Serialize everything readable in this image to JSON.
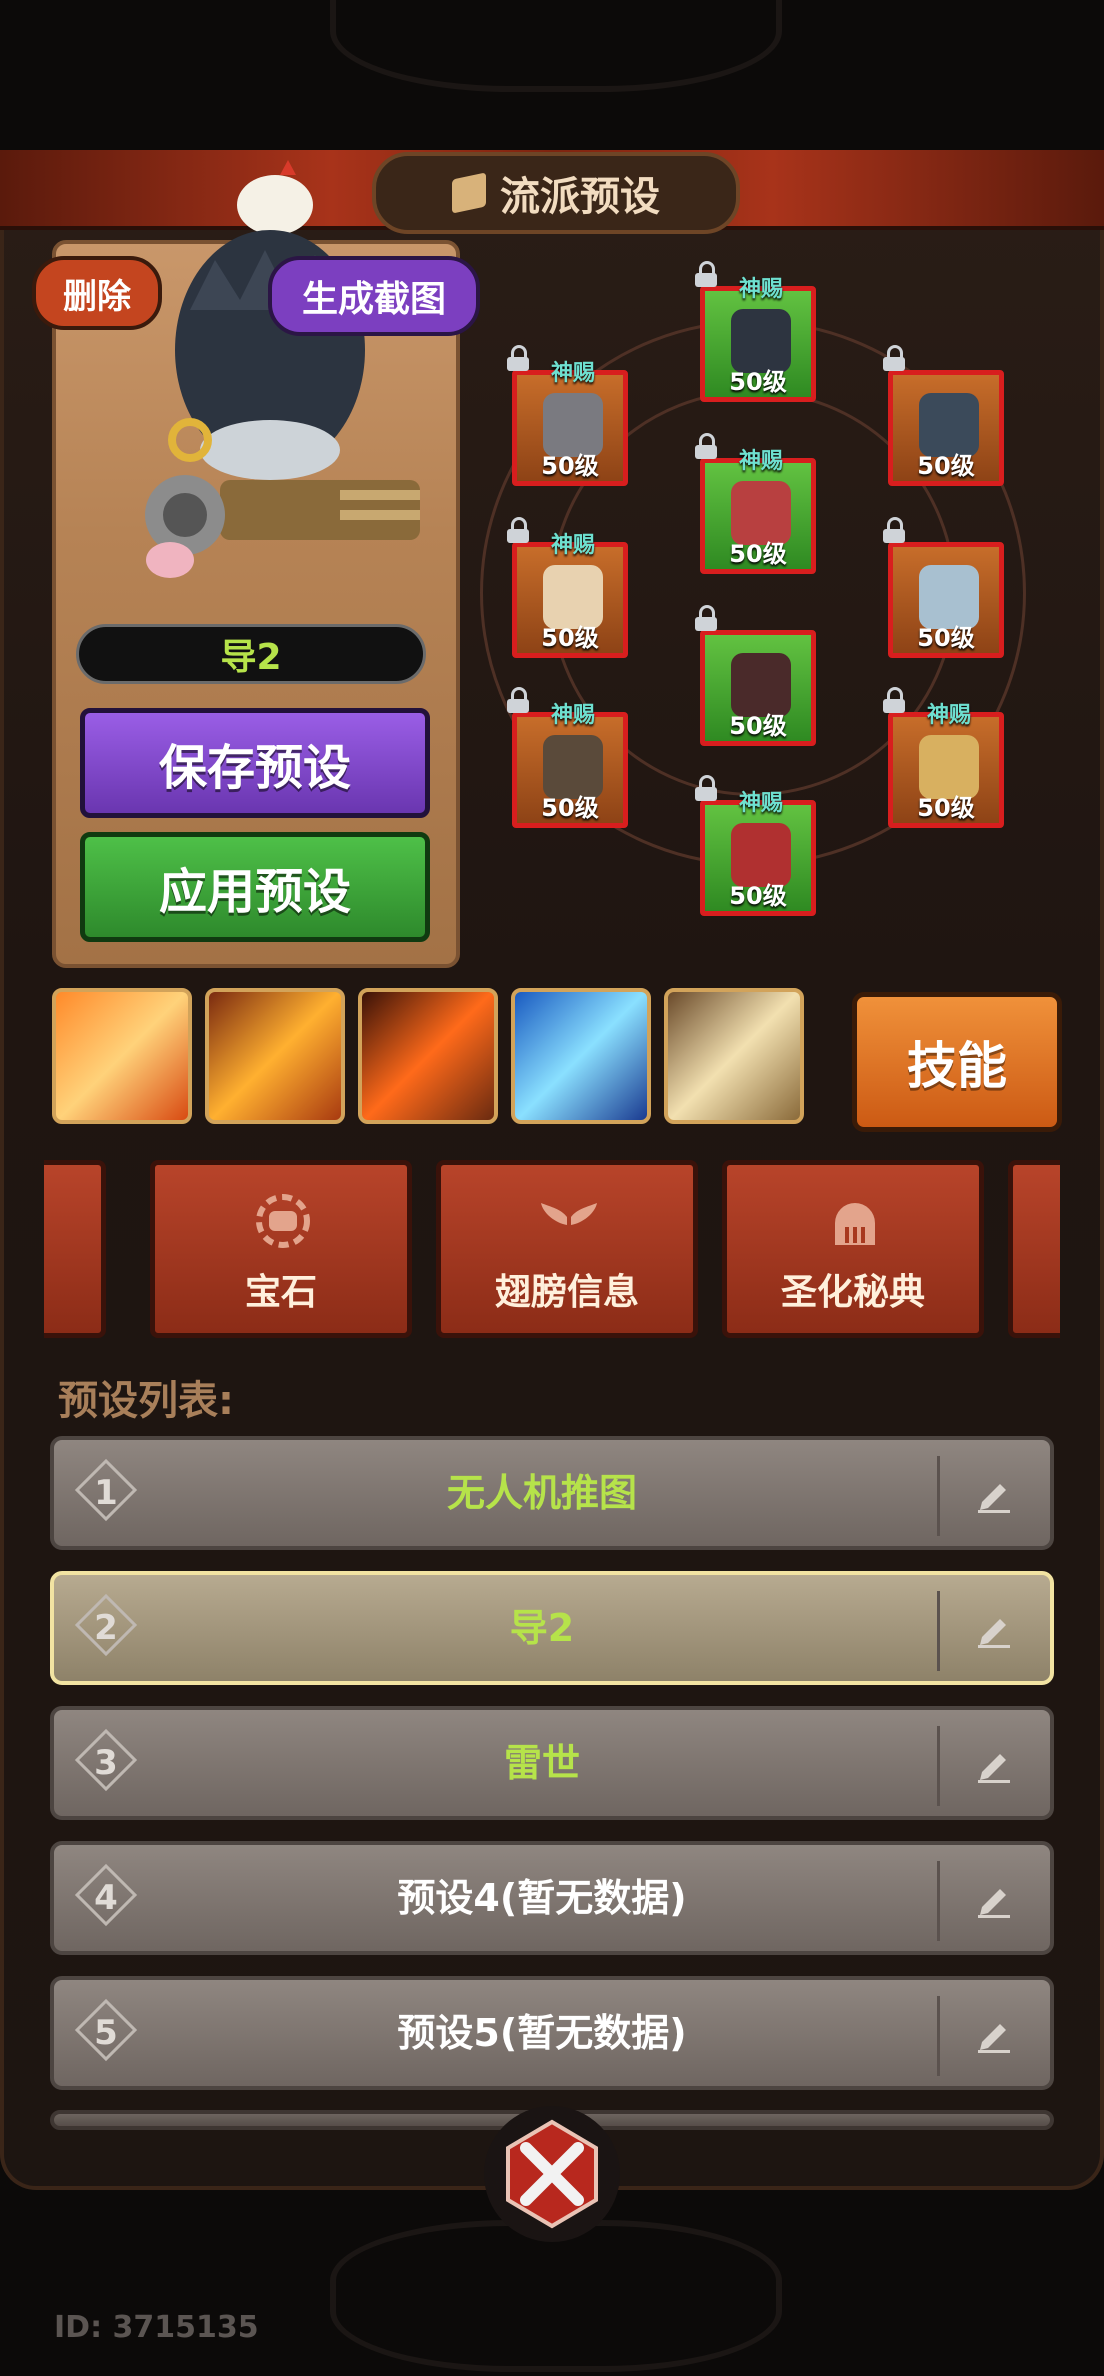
{
  "header": {
    "title": "流派预设"
  },
  "character_card": {
    "delete_label": "删除",
    "screenshot_label": "生成截图",
    "preset_name": "导2",
    "save_label": "保存预设",
    "apply_label": "应用预设"
  },
  "equipment": [
    {
      "tag": "神赐",
      "level": "50级",
      "rarity": "green",
      "item": "cloak"
    },
    {
      "tag": "神赐",
      "level": "50级",
      "rarity": "orange",
      "item": "helmet"
    },
    {
      "tag": "",
      "level": "50级",
      "rarity": "orange",
      "item": "necklace"
    },
    {
      "tag": "神赐",
      "level": "50级",
      "rarity": "green",
      "item": "armor"
    },
    {
      "tag": "神赐",
      "level": "50级",
      "rarity": "orange",
      "item": "bracer"
    },
    {
      "tag": "",
      "level": "50级",
      "rarity": "orange",
      "item": "ring"
    },
    {
      "tag": "",
      "level": "50级",
      "rarity": "green",
      "item": "pants"
    },
    {
      "tag": "神赐",
      "level": "50级",
      "rarity": "orange",
      "item": "claw-gauntlet"
    },
    {
      "tag": "神赐",
      "level": "50级",
      "rarity": "orange",
      "item": "saxophone"
    },
    {
      "tag": "神赐",
      "level": "50级",
      "rarity": "green",
      "item": "boots"
    }
  ],
  "skills": {
    "button_label": "技能",
    "icons": [
      "fire-slash-icon",
      "fire-missiles-icon",
      "fire-fist-icon",
      "ice-crystal-icon",
      "whirlwind-icon"
    ]
  },
  "tabs": [
    {
      "label": "宝石",
      "icon": "gem-icon"
    },
    {
      "label": "翅膀信息",
      "icon": "wings-icon"
    },
    {
      "label": "圣化秘典",
      "icon": "dome-icon"
    }
  ],
  "preset_list": {
    "title": "预设列表:",
    "items": [
      {
        "index": "1",
        "name": "无人机推图",
        "highlight": true,
        "selected": false
      },
      {
        "index": "2",
        "name": "导2",
        "highlight": true,
        "selected": true
      },
      {
        "index": "3",
        "name": "雷世",
        "highlight": true,
        "selected": false
      },
      {
        "index": "4",
        "name": "预设4(暂无数据)",
        "highlight": false,
        "selected": false
      },
      {
        "index": "5",
        "name": "预设5(暂无数据)",
        "highlight": false,
        "selected": false
      }
    ]
  },
  "footer": {
    "id_text": "ID: 3715135"
  },
  "colors": {
    "accent_red": "#c4451f",
    "preset_green": "#b6e34a",
    "level_frame_red": "#d81e1e"
  }
}
